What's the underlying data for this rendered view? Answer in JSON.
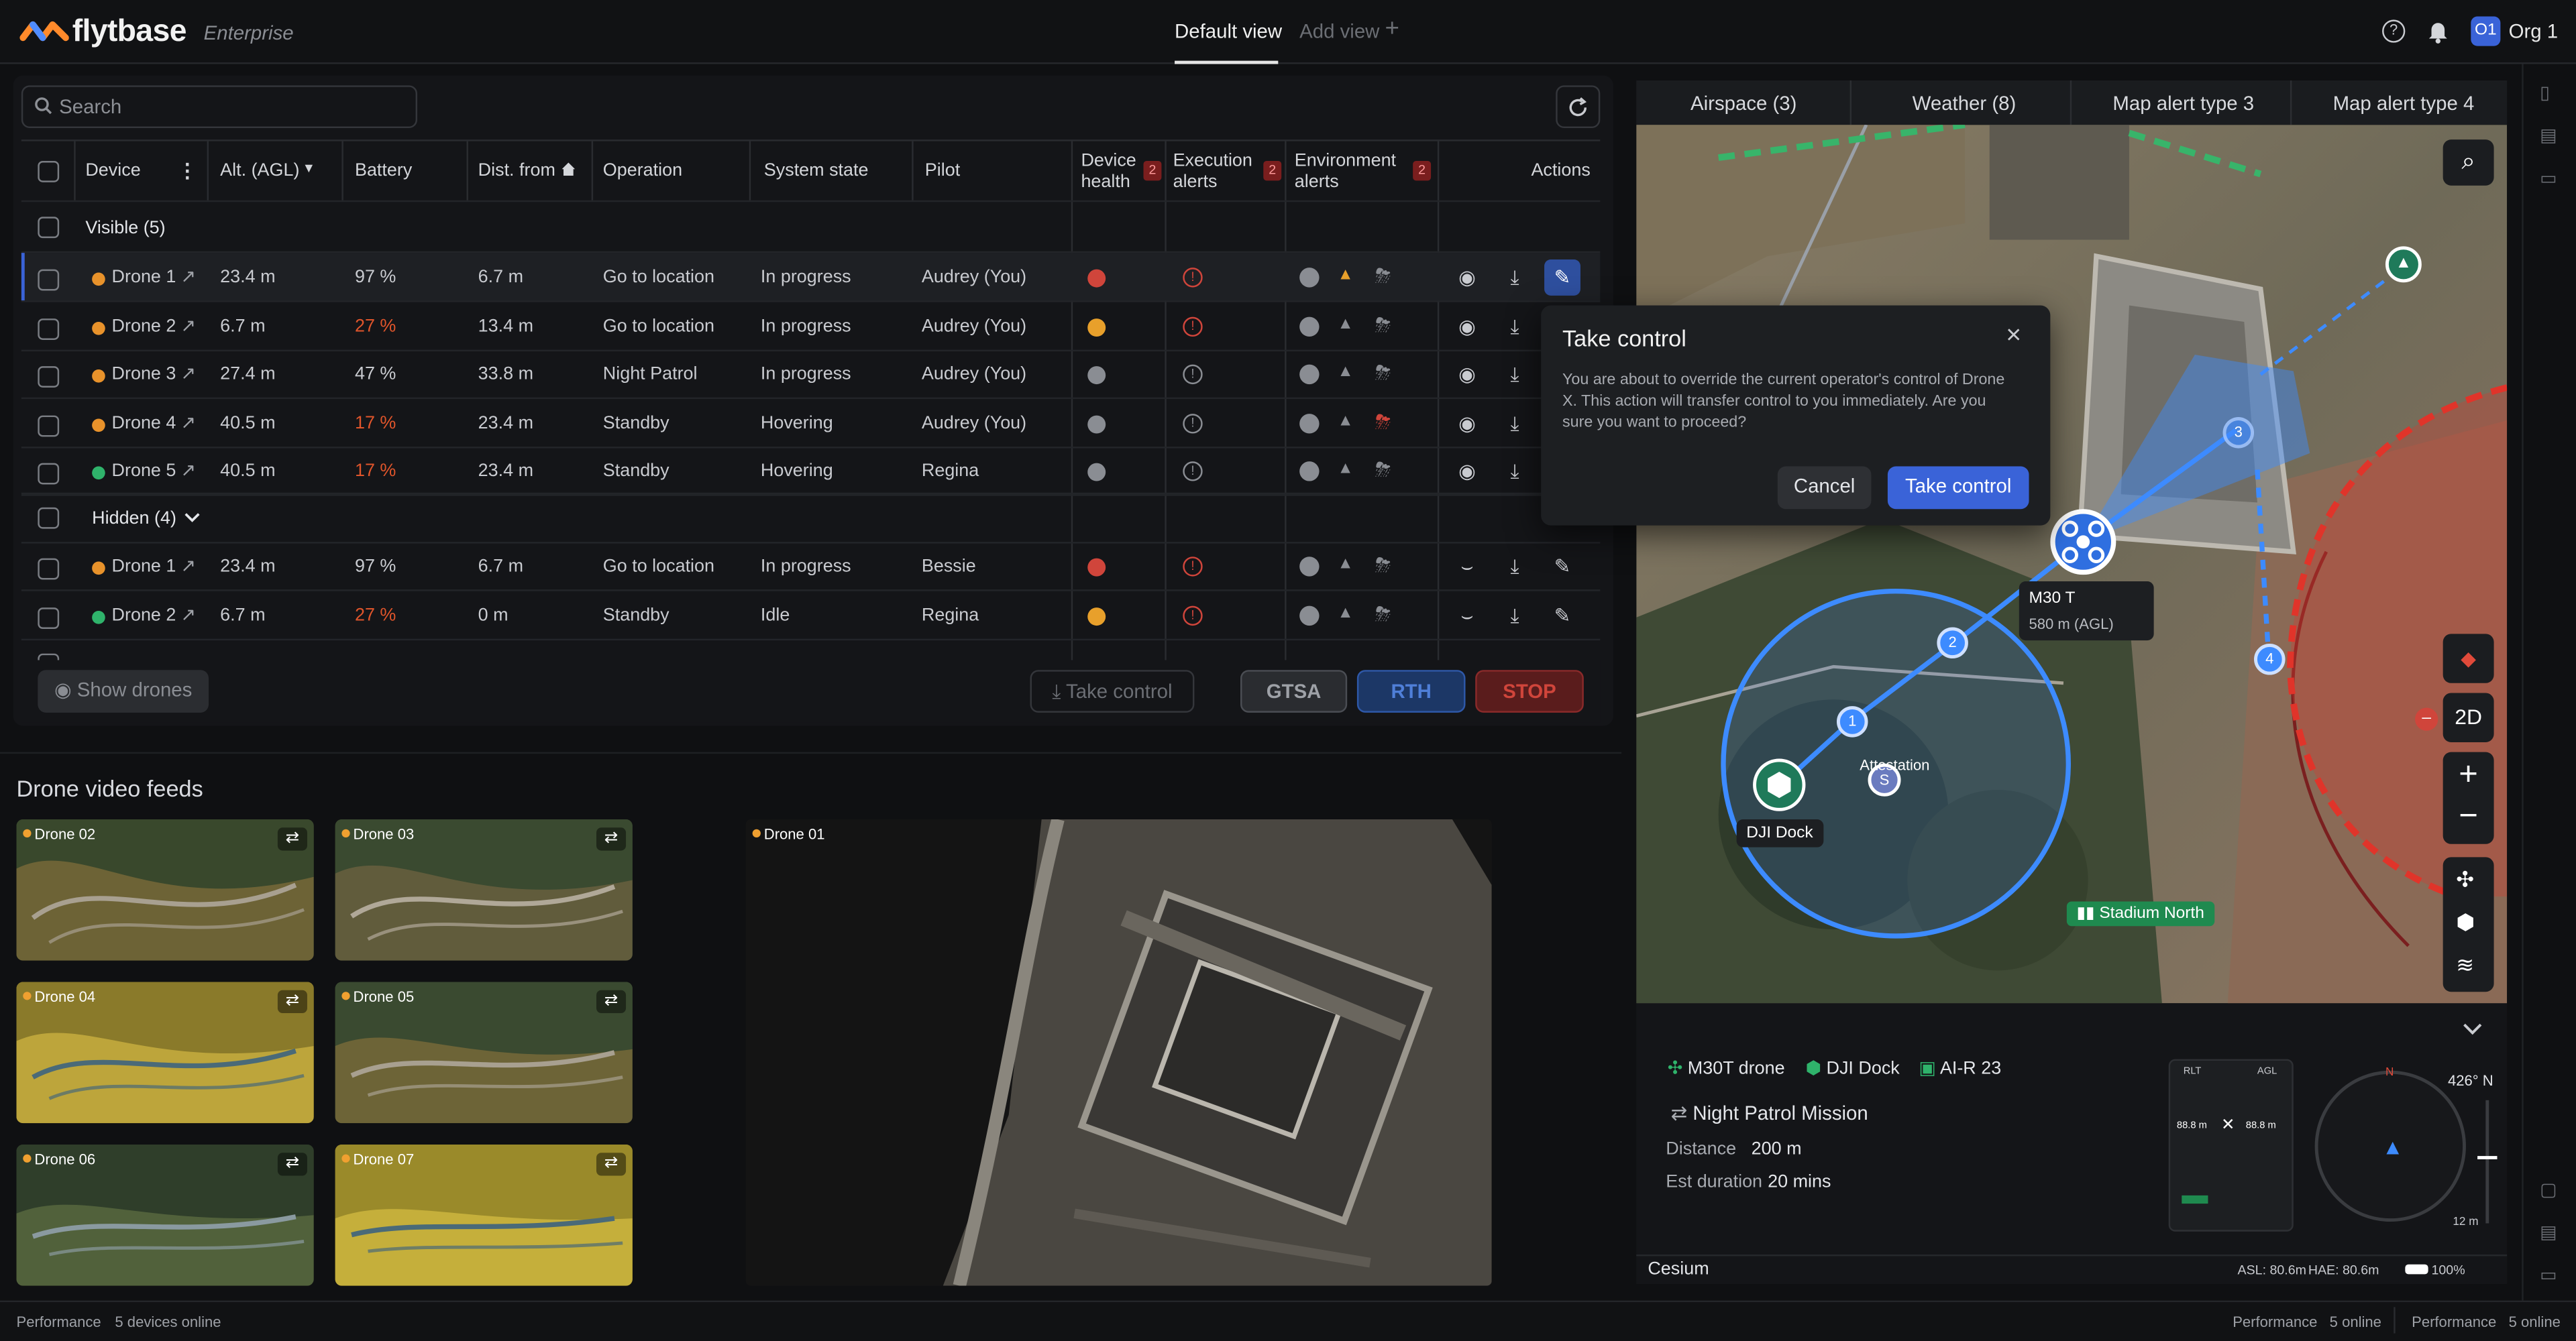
{
  "app": {
    "brand": "flytbase",
    "edition": "Enterprise"
  },
  "header": {
    "tabs": [
      {
        "label": "Default view"
      },
      {
        "label": "Add view"
      }
    ],
    "org_avatar": "O1",
    "org_name": "Org 1"
  },
  "search": {
    "placeholder": "Search"
  },
  "table": {
    "columns": [
      "Device",
      "Alt. (AGL)",
      "Battery",
      "Dist. from",
      "Operation",
      "System state",
      "Pilot",
      "Device health",
      "Execution alerts",
      "Environment alerts",
      "Actions"
    ],
    "header_badges": {
      "device_health": "2",
      "execution_alerts": "2",
      "environment_alerts": "2"
    },
    "groups": {
      "visible": "Visible (5)",
      "hidden": "Hidden (4)"
    },
    "visible_rows": [
      {
        "device": "Drone 1",
        "status_color": "#e8922b",
        "alt": "23.4 m",
        "battery": "97 %",
        "battery_low": false,
        "dist": "6.7 m",
        "operation": "Go to location",
        "state": "In progress",
        "pilot": "Audrey (You)"
      },
      {
        "device": "Drone 2",
        "status_color": "#e8922b",
        "alt": "6.7 m",
        "battery": "27 %",
        "battery_low": true,
        "dist": "13.4 m",
        "operation": "Go to location",
        "state": "In progress",
        "pilot": "Audrey (You)"
      },
      {
        "device": "Drone 3",
        "status_color": "#e8922b",
        "alt": "27.4 m",
        "battery": "47 %",
        "battery_low": false,
        "dist": "33.8 m",
        "operation": "Night Patrol",
        "state": "In progress",
        "pilot": "Audrey (You)"
      },
      {
        "device": "Drone 4",
        "status_color": "#e8922b",
        "alt": "40.5 m",
        "battery": "17 %",
        "battery_low": true,
        "dist": "23.4 m",
        "operation": "Standby",
        "state": "Hovering",
        "pilot": "Audrey (You)"
      },
      {
        "device": "Drone 5",
        "status_color": "#2fb36b",
        "alt": "40.5 m",
        "battery": "17 %",
        "battery_low": true,
        "dist": "23.4 m",
        "operation": "Standby",
        "state": "Hovering",
        "pilot": "Regina"
      }
    ],
    "hidden_rows": [
      {
        "device": "Drone 1",
        "status_color": "#e8922b",
        "alt": "23.4 m",
        "battery": "97 %",
        "battery_low": false,
        "dist": "6.7 m",
        "operation": "Go to location",
        "state": "In progress",
        "pilot": "Bessie"
      },
      {
        "device": "Drone 2",
        "status_color": "#2fb36b",
        "alt": "6.7 m",
        "battery": "27 %",
        "battery_low": true,
        "dist": "0 m",
        "operation": "Standby",
        "state": "Idle",
        "pilot": "Regina"
      }
    ]
  },
  "bottom_actions": {
    "show_drones": "Show drones",
    "take_control": "Take control",
    "gtsa": "GTSA",
    "rth": "RTH",
    "stop": "STOP"
  },
  "feeds": {
    "title": "Drone video feeds",
    "thumbs": [
      "Drone 02",
      "Drone 03",
      "Drone 04",
      "Drone 05",
      "Drone 06",
      "Drone 07"
    ],
    "main": "Drone 01"
  },
  "map": {
    "tabs": [
      "Airspace (3)",
      "Weather (8)",
      "Map alert type 3",
      "Map alert type 4"
    ],
    "drone_label": "M30 T",
    "drone_alt": "580 m (AGL)",
    "dock_label": "DJI Dock",
    "station_label": "Attestation",
    "zone_label": "Stadium North",
    "view_mode": "2D",
    "waypoints": [
      "1",
      "2",
      "3",
      "4"
    ]
  },
  "modal": {
    "title": "Take control",
    "body": "You are about to override the current operator's control of Drone X. This action will transfer control to you immediately. Are you sure you want to proceed?",
    "cancel": "Cancel",
    "confirm": "Take control"
  },
  "info": {
    "drone": "M30T drone",
    "dock": "DJI Dock",
    "ai": "AI-R 23",
    "mission": "Night Patrol Mission",
    "distance_label": "Distance",
    "distance": "200 m",
    "duration_label": "Est duration",
    "duration": "20 mins",
    "gauge_rlt": "RLT",
    "gauge_agl": "AGL",
    "gauge_val": "88.8 m",
    "heading": "426° N",
    "compass_alt": "12 m"
  },
  "map_footer": {
    "engine": "Cesium",
    "asl": "ASL: 80.6m",
    "hae": "HAE: 80.6m",
    "battery": "100%"
  },
  "footer": {
    "left_label": "Performance",
    "left_value": "5 devices online",
    "mid_label": "Performance",
    "mid_value": "5 online",
    "right_label": "Performance",
    "right_value": "5 online"
  },
  "colors": {
    "accent": "#3a63d8",
    "danger": "#e04a3a",
    "warning": "#e8922b",
    "ok": "#2fb36b"
  }
}
